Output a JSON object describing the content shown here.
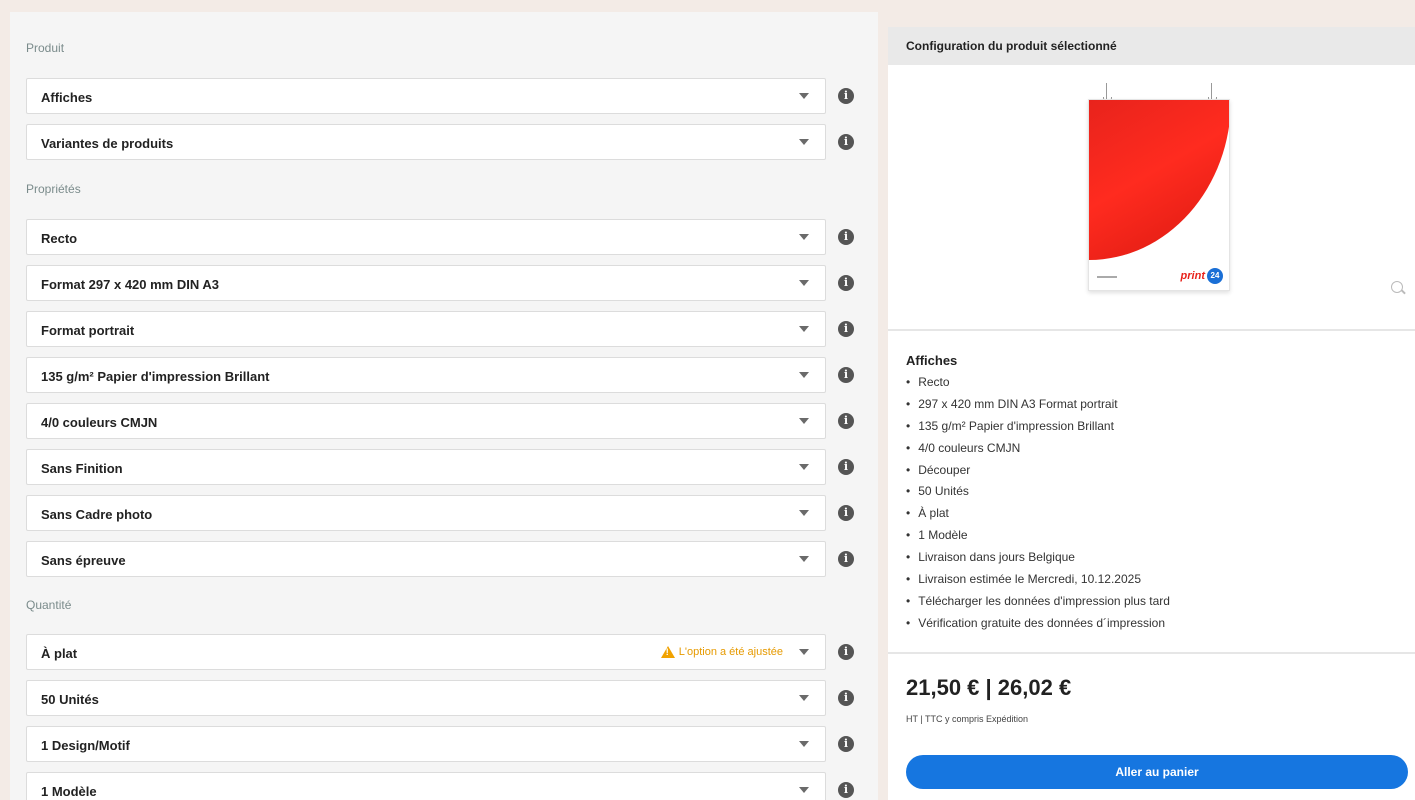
{
  "sections": {
    "product": "Produit",
    "properties": "Propriétés",
    "quantity": "Quantité"
  },
  "product_selects": [
    {
      "value": "Affiches"
    },
    {
      "value": "Variantes de produits"
    }
  ],
  "property_selects": [
    {
      "value": "Recto"
    },
    {
      "value": "Format 297 x 420 mm DIN A3"
    },
    {
      "value": "Format portrait"
    },
    {
      "value": "135 g/m² Papier d'impression Brillant"
    },
    {
      "value": "4/0 couleurs CMJN"
    },
    {
      "value": "Sans Finition"
    },
    {
      "value": "Sans Cadre photo"
    },
    {
      "value": "Sans épreuve"
    }
  ],
  "quantity_selects": [
    {
      "value": "À plat",
      "warning": "L'option a été ajustée"
    },
    {
      "value": "50 Unités"
    },
    {
      "value": "1 Design/Motif"
    },
    {
      "value": "1 Modèle"
    }
  ],
  "config": {
    "header": "Configuration du produit sélectionné",
    "poster_brand": "print",
    "poster_badge": "24",
    "summary_title": "Affiches",
    "summary_items": [
      "Recto",
      "297 x 420 mm DIN A3 Format portrait",
      "135 g/m² Papier d'impression Brillant",
      "4/0 couleurs CMJN",
      "Découper",
      "50 Unités",
      "À plat",
      "1 Modèle",
      "Livraison dans jours Belgique",
      "Livraison estimée le Mercredi, 10.12.2025",
      "Télécharger les données d'impression plus tard",
      "Vérification gratuite des données d´impression"
    ],
    "price": "21,50 € | 26,02 €",
    "price_note": "HT | TTC y compris Expédition",
    "cart_button": "Aller au panier"
  },
  "colors": {
    "accent": "#1676e0",
    "warning": "#f1a200",
    "poster_red": "#e8231c"
  },
  "icons": {
    "info": "info-icon",
    "caret": "chevron-down-icon",
    "warning": "warning-icon",
    "zoom": "search-icon"
  }
}
